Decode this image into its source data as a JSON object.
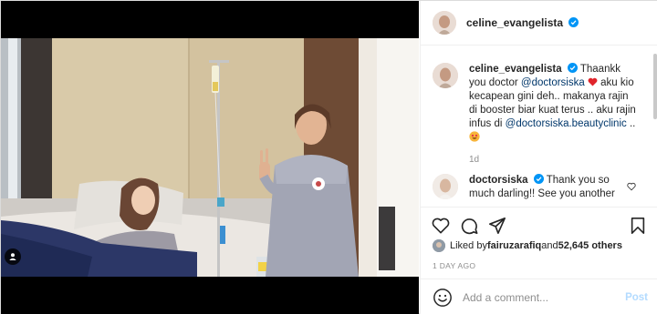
{
  "post": {
    "username": "celine_evangelista",
    "verified": true
  },
  "caption": {
    "username": "celine_evangelista",
    "text_1": "Thaankk you doctor ",
    "mention_1": "@doctorsiska",
    "text_2": " aku kio kecapean gini deh.. makanya rajin di booster biar kuat terus .. aku rajin infus di ",
    "mention_2": "@doctorsiska.beautyclinic",
    "text_3": " ..",
    "time": "1d"
  },
  "reply": {
    "username": "doctorsiska",
    "verified": true,
    "text": "Thank you so much darling!! See you another"
  },
  "likes": {
    "prefix": "Liked by ",
    "user": "fairuzarafiq",
    "middle": " and ",
    "count": "52,645 others"
  },
  "timestamp": "1 DAY AGO",
  "add_comment": {
    "placeholder": "Add a comment...",
    "post_label": "Post"
  },
  "colors": {
    "accent_blue": "#0095f6",
    "mention_blue": "#00376b",
    "heart_red": "#ed4956",
    "post_disabled": "#b3dbff"
  },
  "icons": [
    "user-tag-icon",
    "verified-badge-icon",
    "heart-icon",
    "comment-icon",
    "share-icon",
    "save-icon",
    "emoji-icon",
    "heart-emoji",
    "smile-emoji"
  ]
}
